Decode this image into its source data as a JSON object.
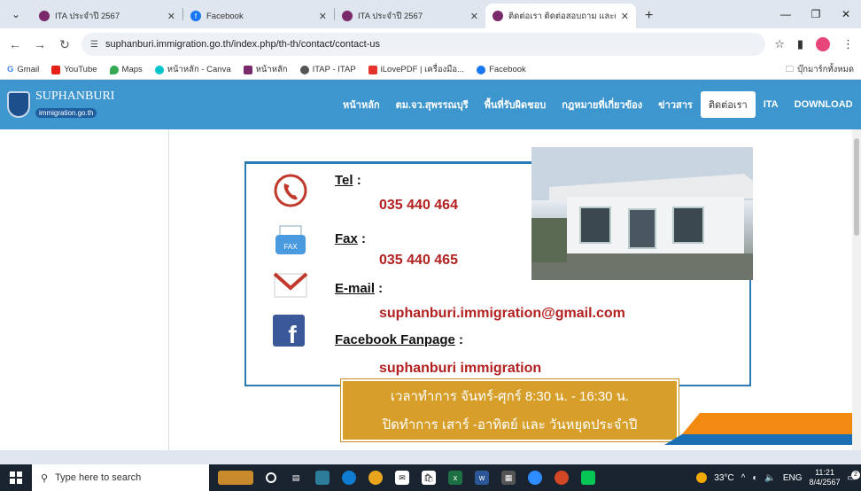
{
  "browser": {
    "tabs": [
      {
        "title": "ITA ประจำปี 2567",
        "active": false
      },
      {
        "title": "Facebook",
        "active": false
      },
      {
        "title": "ITA ประจำปี 2567",
        "active": false
      },
      {
        "title": "ติดต่อเรา ติดต่อสอบถาม และติดตาม",
        "active": true
      }
    ],
    "url": "suphanburi.immigration.go.th/index.php/th-th/contact/contact-us",
    "bookmarks": [
      "Gmail",
      "YouTube",
      "Maps",
      "หน้าหลัก - Canva",
      "หน้าหลัก",
      "ITAP - ITAP",
      "iLovePDF | เครื่องมือ...",
      "Facebook"
    ],
    "bookmarks_folder": "บุ๊กมาร์กทั้งหมด"
  },
  "site": {
    "logo_name": "SUPHANBURI",
    "logo_sub": "immigration.go.th",
    "menu": [
      "หน้าหลัก",
      "ตม.จว.สุพรรณบุรี",
      "พื้นที่รับผิดชอบ",
      "กฎหมายที่เกี่ยวข้อง",
      "ข่าวสาร",
      "ติดต่อเรา",
      "ITA",
      "DOWNLOAD"
    ],
    "active_menu": "ติดต่อเรา"
  },
  "contact": {
    "tel_label": "Tel",
    "tel": "035 440 464",
    "fax_label": "Fax",
    "fax": "035 440 465",
    "email_label": "E-mail",
    "email": "suphanburi.immigration@gmail.com",
    "fb_label": "Facebook Fanpage",
    "fb": "suphanburi immigration",
    "fax_icon_text": "FAX",
    "hours_line1": "เวลาทำการ จันทร์-ศุกร์ 8:30 น. - 16:30 น.",
    "hours_line2": "ปิดทำการ เสาร์ -อาทิตย์ และ วันหยุดประจำปี"
  },
  "taskbar": {
    "search_placeholder": "Type here to search",
    "weather": "33°C",
    "lang": "ENG",
    "time": "11:21",
    "date": "8/4/2567",
    "notif_count": "2"
  }
}
